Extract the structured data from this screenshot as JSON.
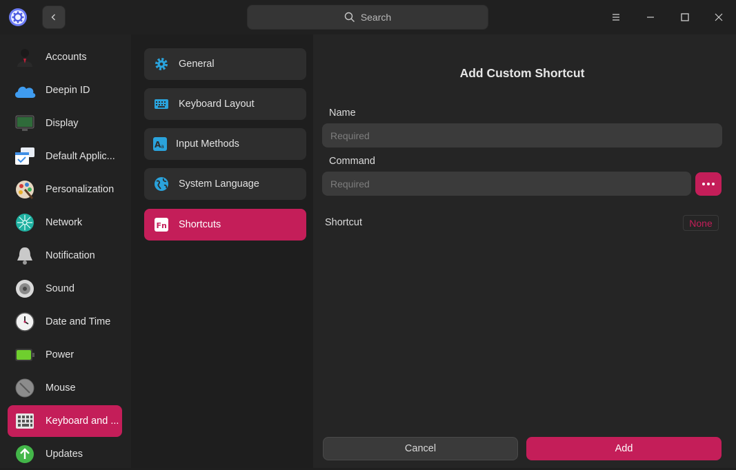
{
  "header": {
    "search_placeholder": "Search",
    "icons": [
      "gear-app-logo-icon",
      "chevron-left-icon",
      "search-icon",
      "menu-icon",
      "minimize-icon",
      "maximize-icon",
      "close-icon"
    ]
  },
  "sidebar": {
    "items": [
      {
        "label": "Accounts",
        "icon": "accounts-icon"
      },
      {
        "label": "Deepin ID",
        "icon": "cloud-icon"
      },
      {
        "label": "Display",
        "icon": "display-icon"
      },
      {
        "label": "Default Applic...",
        "icon": "default-apps-icon"
      },
      {
        "label": "Personalization",
        "icon": "palette-icon"
      },
      {
        "label": "Network",
        "icon": "network-icon"
      },
      {
        "label": "Notification",
        "icon": "bell-icon"
      },
      {
        "label": "Sound",
        "icon": "speaker-icon"
      },
      {
        "label": "Date and Time",
        "icon": "clock-icon"
      },
      {
        "label": "Power",
        "icon": "battery-icon"
      },
      {
        "label": "Mouse",
        "icon": "mouse-icon"
      },
      {
        "label": "Keyboard and ...",
        "icon": "keyboard-icon",
        "active": true
      },
      {
        "label": "Updates",
        "icon": "update-icon"
      }
    ]
  },
  "submenu": {
    "items": [
      {
        "label": "General",
        "icon": "gear-icon"
      },
      {
        "label": "Keyboard Layout",
        "icon": "keyboard-layout-icon"
      },
      {
        "label": "Input Methods",
        "icon": "input-methods-icon"
      },
      {
        "label": "System Language",
        "icon": "globe-icon"
      },
      {
        "label": "Shortcuts",
        "icon": "fn-icon",
        "active": true
      }
    ]
  },
  "dialog": {
    "title": "Add Custom Shortcut",
    "name_label": "Name",
    "name_placeholder": "Required",
    "command_label": "Command",
    "command_placeholder": "Required",
    "shortcut_label": "Shortcut",
    "shortcut_value": "None",
    "cancel_label": "Cancel",
    "add_label": "Add"
  },
  "colors": {
    "accent": "#c41e59",
    "background": "#252525",
    "sidebar": "#222222"
  }
}
